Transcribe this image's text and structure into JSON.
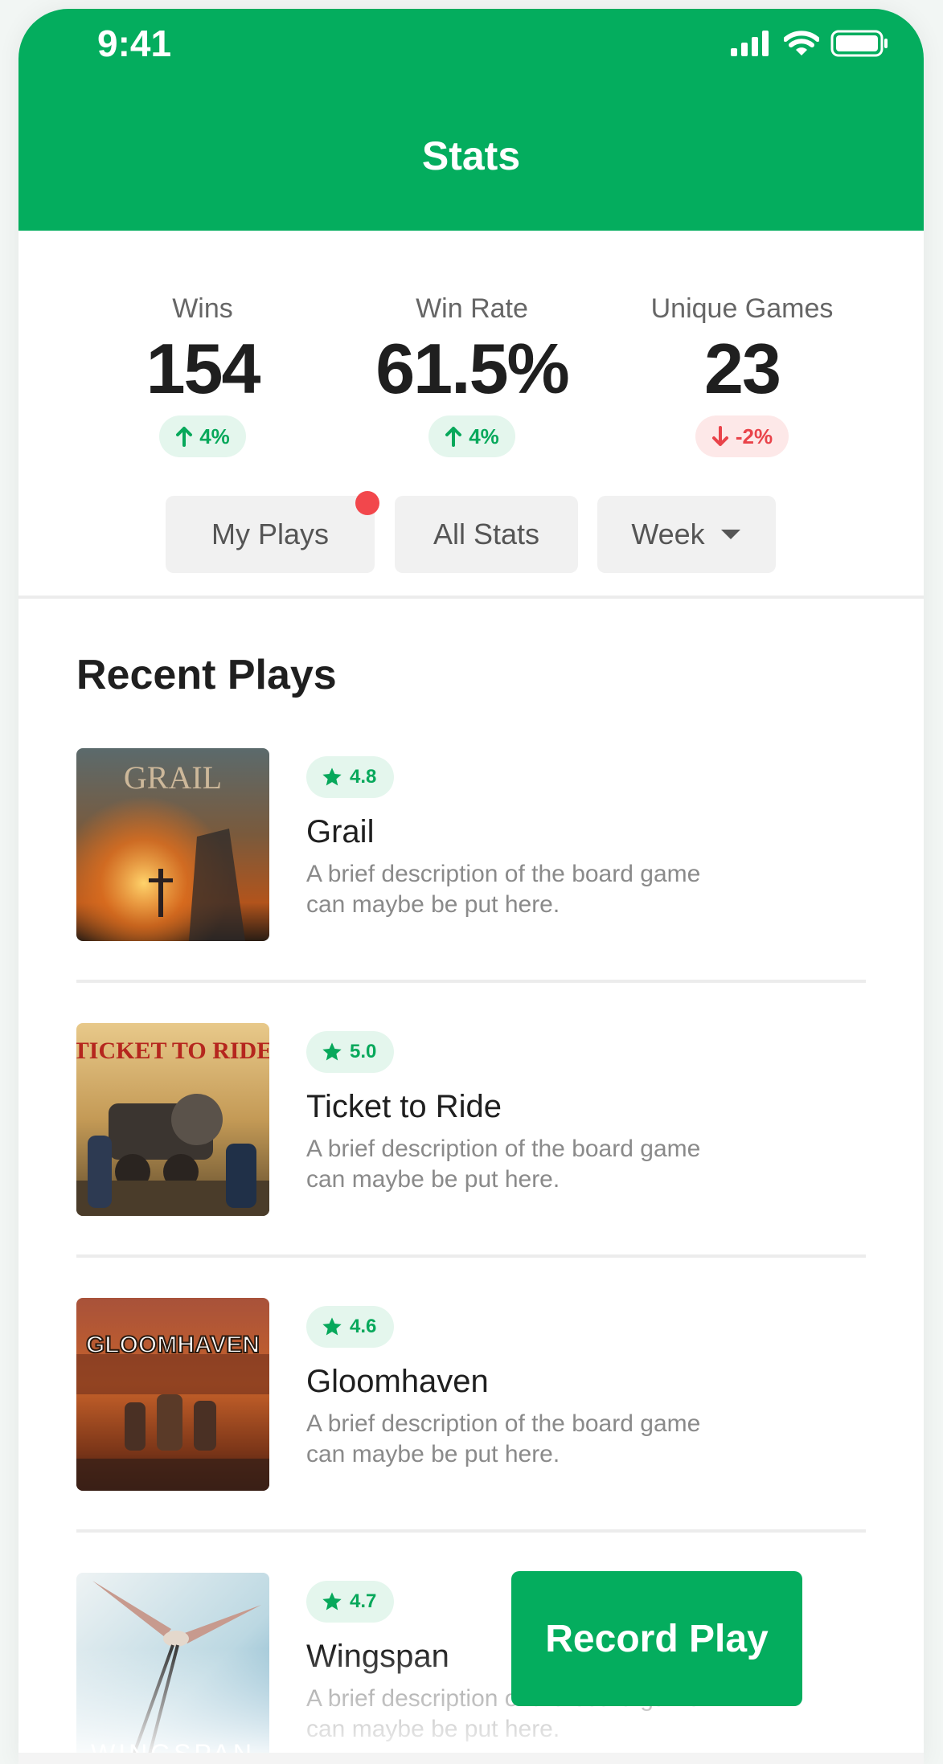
{
  "status_bar": {
    "time": "9:41"
  },
  "header": {
    "title": "Stats"
  },
  "stats": [
    {
      "label": "Wins",
      "value": "154",
      "delta": "4%",
      "trend": "up"
    },
    {
      "label": "Win Rate",
      "value": "61.5%",
      "delta": "4%",
      "trend": "up"
    },
    {
      "label": "Unique Games",
      "value": "23",
      "delta": "-2%",
      "trend": "down"
    }
  ],
  "tabs": {
    "my_plays": "My Plays",
    "all_stats": "All Stats",
    "period": "Week"
  },
  "recent": {
    "title": "Recent Plays",
    "items": [
      {
        "rating": "4.8",
        "title": "Grail",
        "description": "A brief description of the board game can maybe be put here.",
        "cover_text": "GRAIL"
      },
      {
        "rating": "5.0",
        "title": "Ticket to Ride",
        "description": "A brief description of the board game can maybe be put here.",
        "cover_text": "TICKET TO RIDE"
      },
      {
        "rating": "4.6",
        "title": "Gloomhaven",
        "description": "A brief description of the board game can maybe be put here.",
        "cover_text": "GLOOMHAVEN"
      },
      {
        "rating": "4.7",
        "title": "Wingspan",
        "description": "A brief description of the board game can maybe be put here.",
        "cover_text": "WINGSPAN"
      }
    ]
  },
  "record_button": {
    "label": "Record Play"
  },
  "colors": {
    "brand": "#04ad5e",
    "up": "#07a85b",
    "down": "#e9434a",
    "dot": "#f2474c"
  }
}
